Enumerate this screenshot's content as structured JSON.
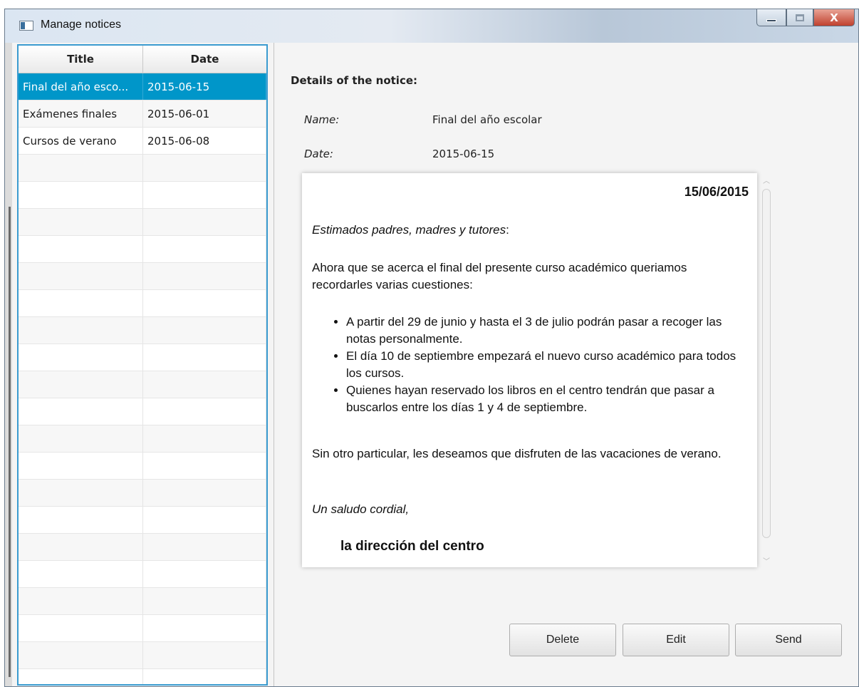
{
  "window": {
    "title": "Manage notices",
    "controls": {
      "minimize": "minimize",
      "maximize": "maximize",
      "close": "X"
    }
  },
  "table": {
    "columns": [
      "Title",
      "Date"
    ],
    "rows": [
      {
        "title": "Final del año esco...",
        "date": "2015-06-15",
        "selected": true
      },
      {
        "title": "Exámenes finales",
        "date": "2015-06-01",
        "selected": false
      },
      {
        "title": "Cursos de verano",
        "date": "2015-06-08",
        "selected": false
      }
    ]
  },
  "details": {
    "heading": "Details of the notice:",
    "name_label": "Name:",
    "name_value": "Final del año escolar",
    "date_label": "Date:",
    "date_value": "2015-06-15"
  },
  "notice": {
    "date": "15/06/2015",
    "greeting": "Estimados padres, madres y tutores",
    "greeting_suffix": ":",
    "intro": "Ahora que se acerca el final del presente curso académico queriamos recordarles varias cuestiones:",
    "items": [
      "A partir del 29 de junio y hasta el 3 de julio podrán pasar a recoger las notas personalmente.",
      "El día 10 de septiembre empezará el nuevo curso académico para todos los cursos.",
      "Quienes hayan reservado los libros en el centro tendrán que pasar a buscarlos entre los días 1 y 4 de septiembre."
    ],
    "closing": "Sin otro particular, les deseamos que disfruten de las vacaciones de verano.",
    "saludo": "Un saludo cordial,",
    "signature": "la dirección del centro"
  },
  "buttons": {
    "delete": "Delete",
    "edit": "Edit",
    "send": "Send"
  },
  "colors": {
    "selection": "#0096c9",
    "table_border": "#3a9bd0",
    "close_button": "#c0412e"
  }
}
